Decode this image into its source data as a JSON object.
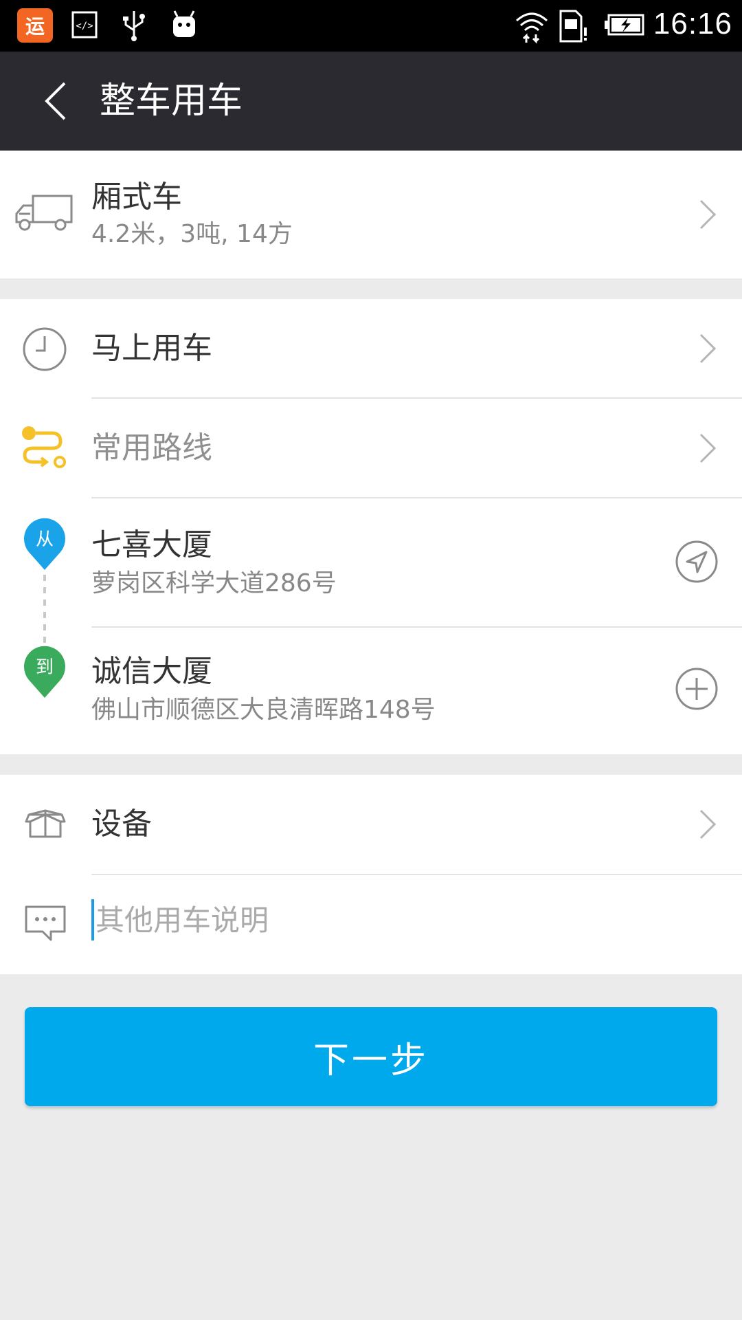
{
  "status_bar": {
    "time": "16:16",
    "app_icon_text": "运",
    "icons": [
      "app-icon",
      "code-icon",
      "usb-icon",
      "android-debug-icon",
      "wifi-icon",
      "sim-icon",
      "battery-charging-icon"
    ]
  },
  "header": {
    "title": "整车用车",
    "back_icon": "back-arrow-icon"
  },
  "vehicle": {
    "name": "厢式车",
    "spec": "4.2米，3吨, 14方",
    "icon": "truck-icon"
  },
  "schedule": {
    "time_label": "马上用车",
    "route_label": "常用路线"
  },
  "route": {
    "from_pin": "从",
    "from_name": "七喜大厦",
    "from_address": "萝岗区科学大道286号",
    "to_pin": "到",
    "to_name": "诚信大厦",
    "to_address": "佛山市顺德区大良清晖路148号"
  },
  "extras": {
    "equipment_label": "设备",
    "remark_placeholder": "其他用车说明",
    "remark_value": ""
  },
  "actions": {
    "next_label": "下一步"
  },
  "colors": {
    "primary": "#00a8ec",
    "from_pin": "#1aa3e8",
    "to_pin": "#3aaa5c",
    "route_icon": "#f5c129",
    "title_bar": "#2a2a30",
    "background": "#ebebeb"
  }
}
